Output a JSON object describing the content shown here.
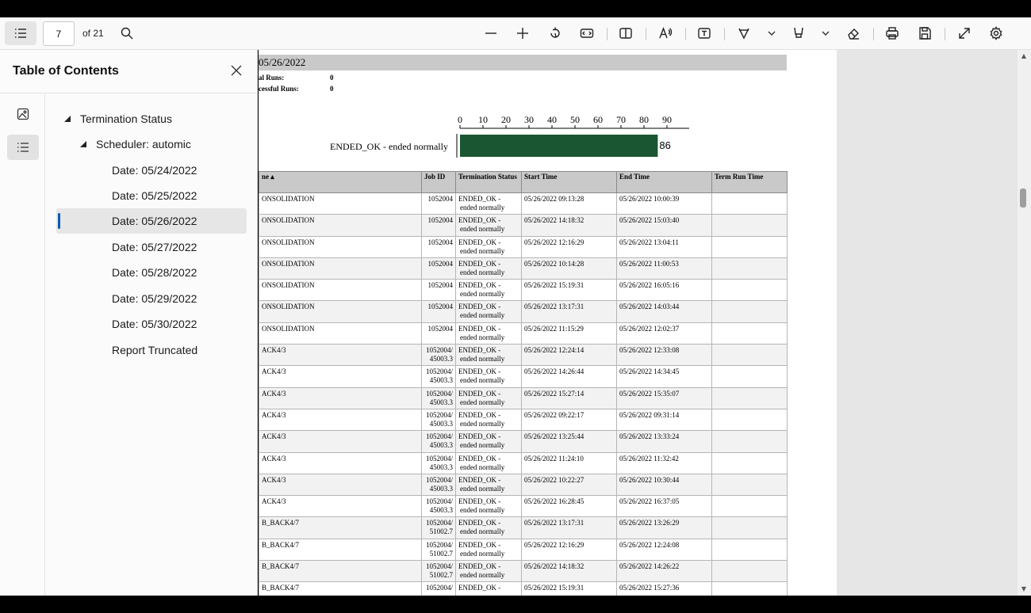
{
  "toolbar": {
    "page_number": "7",
    "page_of": "of 21"
  },
  "sidebar": {
    "title": "Table of Contents",
    "items": [
      {
        "label": "Termination Status"
      },
      {
        "label": "Scheduler: automic"
      },
      {
        "label": "Date: 05/24/2022"
      },
      {
        "label": "Date: 05/25/2022"
      },
      {
        "label": "Date: 05/26/2022"
      },
      {
        "label": "Date: 05/27/2022"
      },
      {
        "label": "Date: 05/28/2022"
      },
      {
        "label": "Date: 05/29/2022"
      },
      {
        "label": "Date: 05/30/2022"
      },
      {
        "label": "Report Truncated"
      }
    ],
    "selected_index": 4
  },
  "report": {
    "date_header": "05/26/2022",
    "summary": [
      {
        "label": "al Runs:",
        "value": "0"
      },
      {
        "label": "cessful Runs:",
        "value": "0"
      }
    ],
    "columns": [
      "ne ▴",
      "Job ID",
      "Termination Status",
      "Start Time",
      "End Time",
      "Term Run Time"
    ],
    "rows": [
      {
        "name": "ONSOLIDATION",
        "job1": "1052004",
        "job2": "",
        "status1": "ENDED_OK -",
        "status2": "ended normally",
        "start": "05/26/2022 09:13:28",
        "end": "05/26/2022 10:00:39",
        "term": ""
      },
      {
        "name": "ONSOLIDATION",
        "job1": "1052004",
        "job2": "",
        "status1": "ENDED_OK -",
        "status2": "ended normally",
        "start": "05/26/2022 14:18:32",
        "end": "05/26/2022 15:03:40",
        "term": ""
      },
      {
        "name": "ONSOLIDATION",
        "job1": "1052004",
        "job2": "",
        "status1": "ENDED_OK -",
        "status2": "ended normally",
        "start": "05/26/2022 12:16:29",
        "end": "05/26/2022 13:04:11",
        "term": ""
      },
      {
        "name": "ONSOLIDATION",
        "job1": "1052004",
        "job2": "",
        "status1": "ENDED_OK -",
        "status2": "ended normally",
        "start": "05/26/2022 10:14:28",
        "end": "05/26/2022 11:00:53",
        "term": ""
      },
      {
        "name": "ONSOLIDATION",
        "job1": "1052004",
        "job2": "",
        "status1": "ENDED_OK -",
        "status2": "ended normally",
        "start": "05/26/2022 15:19:31",
        "end": "05/26/2022 16:05:16",
        "term": ""
      },
      {
        "name": "ONSOLIDATION",
        "job1": "1052004",
        "job2": "",
        "status1": "ENDED_OK -",
        "status2": "ended normally",
        "start": "05/26/2022 13:17:31",
        "end": "05/26/2022 14:03:44",
        "term": ""
      },
      {
        "name": "ONSOLIDATION",
        "job1": "1052004",
        "job2": "",
        "status1": "ENDED_OK -",
        "status2": "ended normally",
        "start": "05/26/2022 11:15:29",
        "end": "05/26/2022 12:02:37",
        "term": ""
      },
      {
        "name": "ACK4/3",
        "job1": "1052004/",
        "job2": "45003.3",
        "status1": "ENDED_OK -",
        "status2": "ended normally",
        "start": "05/26/2022 12:24:14",
        "end": "05/26/2022 12:33:08",
        "term": ""
      },
      {
        "name": "ACK4/3",
        "job1": "1052004/",
        "job2": "45003.3",
        "status1": "ENDED_OK -",
        "status2": "ended normally",
        "start": "05/26/2022 14:26:44",
        "end": "05/26/2022 14:34:45",
        "term": ""
      },
      {
        "name": "ACK4/3",
        "job1": "1052004/",
        "job2": "45003.3",
        "status1": "ENDED_OK -",
        "status2": "ended normally",
        "start": "05/26/2022 15:27:14",
        "end": "05/26/2022 15:35:07",
        "term": ""
      },
      {
        "name": "ACK4/3",
        "job1": "1052004/",
        "job2": "45003.3",
        "status1": "ENDED_OK -",
        "status2": "ended normally",
        "start": "05/26/2022 09:22:17",
        "end": "05/26/2022 09:31:14",
        "term": ""
      },
      {
        "name": "ACK4/3",
        "job1": "1052004/",
        "job2": "45003.3",
        "status1": "ENDED_OK -",
        "status2": "ended normally",
        "start": "05/26/2022 13:25:44",
        "end": "05/26/2022 13:33:24",
        "term": ""
      },
      {
        "name": "ACK4/3",
        "job1": "1052004/",
        "job2": "45003.3",
        "status1": "ENDED_OK -",
        "status2": "ended normally",
        "start": "05/26/2022 11:24:10",
        "end": "05/26/2022 11:32:42",
        "term": ""
      },
      {
        "name": "ACK4/3",
        "job1": "1052004/",
        "job2": "45003.3",
        "status1": "ENDED_OK -",
        "status2": "ended normally",
        "start": "05/26/2022 10:22:27",
        "end": "05/26/2022 10:30:44",
        "term": ""
      },
      {
        "name": "ACK4/3",
        "job1": "1052004/",
        "job2": "45003.3",
        "status1": "ENDED_OK -",
        "status2": "ended normally",
        "start": "05/26/2022 16:28:45",
        "end": "05/26/2022 16:37:05",
        "term": ""
      },
      {
        "name": "B_BACK4/7",
        "job1": "1052004/",
        "job2": "51002.7",
        "status1": "ENDED_OK -",
        "status2": "ended normally",
        "start": "05/26/2022 13:17:31",
        "end": "05/26/2022 13:26:29",
        "term": ""
      },
      {
        "name": "B_BACK4/7",
        "job1": "1052004/",
        "job2": "51002.7",
        "status1": "ENDED_OK -",
        "status2": "ended normally",
        "start": "05/26/2022 12:16:29",
        "end": "05/26/2022 12:24:08",
        "term": ""
      },
      {
        "name": "B_BACK4/7",
        "job1": "1052004/",
        "job2": "51002.7",
        "status1": "ENDED_OK -",
        "status2": "ended normally",
        "start": "05/26/2022 14:18:32",
        "end": "05/26/2022 14:26:22",
        "term": ""
      },
      {
        "name": "B_BACK4/7",
        "job1": "1052004/",
        "job2": "",
        "status1": "ENDED_OK -",
        "status2": "",
        "start": "05/26/2022 15:19:31",
        "end": "05/26/2022 15:27:36",
        "term": ""
      }
    ]
  },
  "chart_data": {
    "type": "bar",
    "orientation": "horizontal",
    "categories": [
      "ENDED_OK - ended normally"
    ],
    "values": [
      86
    ],
    "xlim": [
      0,
      90
    ],
    "xticks": [
      0,
      10,
      20,
      30,
      40,
      50,
      60,
      70,
      80,
      90
    ],
    "bar_color": "#1a5631",
    "data_labels": [
      "86"
    ]
  },
  "colors": {
    "accent": "#0b5cad",
    "header_band": "#c9c9c9"
  }
}
